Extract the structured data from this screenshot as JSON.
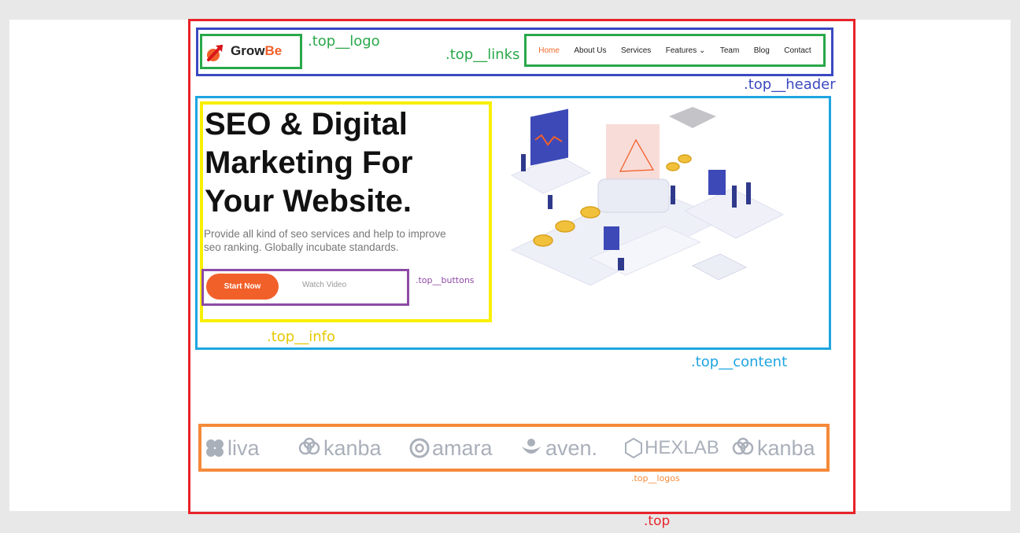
{
  "logo": {
    "name_dark": "Grow",
    "name_accent": "Be"
  },
  "nav": {
    "items": [
      {
        "label": "Home",
        "active": true
      },
      {
        "label": "About Us"
      },
      {
        "label": "Services"
      },
      {
        "label": "Features ⌄"
      },
      {
        "label": "Team"
      },
      {
        "label": "Blog"
      },
      {
        "label": "Contact"
      }
    ]
  },
  "hero": {
    "title": "SEO & Digital Marketing For Your Website.",
    "description": "Provide all kind of seo services and help to improve seo ranking. Globally incubate standards.",
    "start_label": "Start Now",
    "watch_label": "Watch Video"
  },
  "brands": [
    "liva",
    "kanba",
    "amara",
    "aven.",
    "HEXLAB",
    "kanba"
  ],
  "annotations": {
    "top": ".top",
    "header": ".top__header",
    "logo": ".top__logo",
    "links": ".top__links",
    "content": ".top__content",
    "info": ".top__info",
    "buttons": ".top__buttons",
    "logos": ".top__logos"
  },
  "colors": {
    "accent": "#f2602a",
    "top": "#e8232a",
    "header": "#3b48c1",
    "green": "#29a84a",
    "content": "#1ea5e0",
    "info": "#f8f000",
    "buttons": "#8d4aa6",
    "logos": "#f58a3a"
  }
}
